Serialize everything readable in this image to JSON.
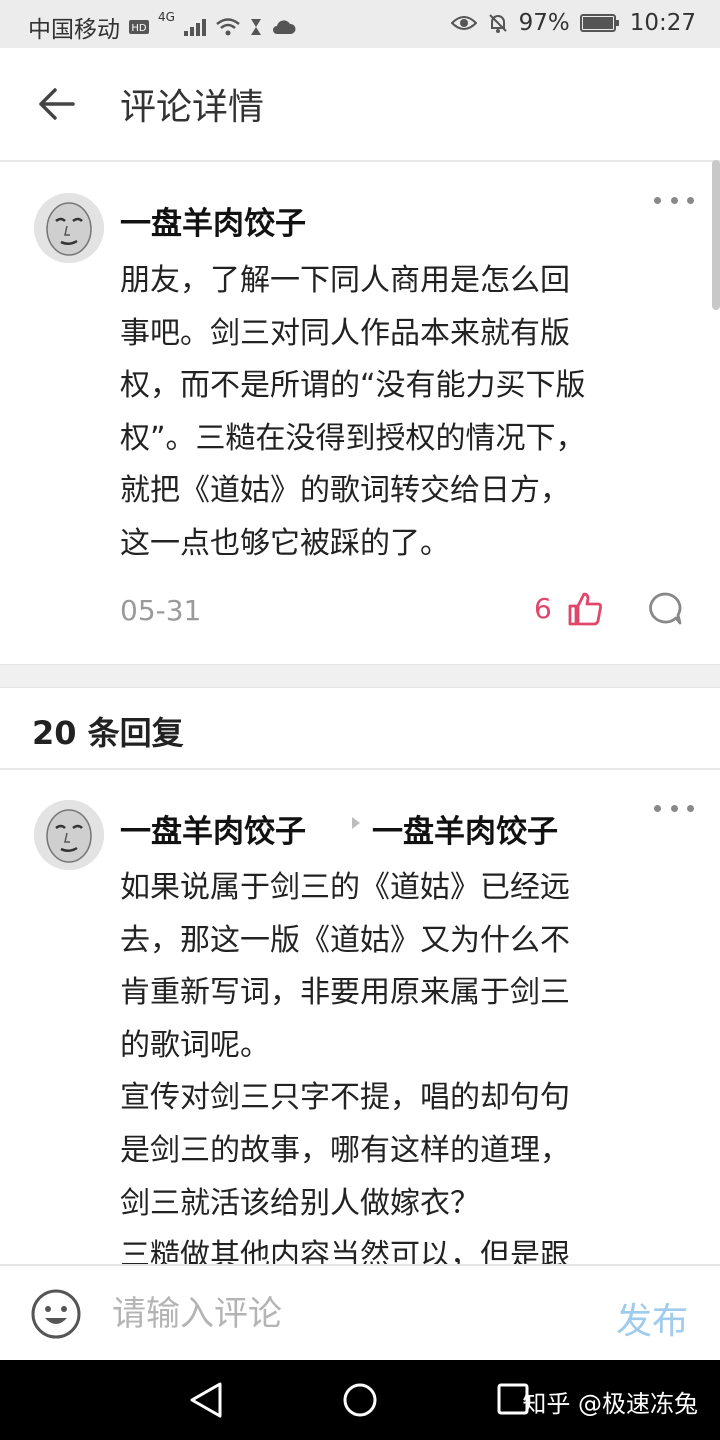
{
  "status_bar": {
    "carrier": "中国移动",
    "network": "4G",
    "battery": "97%",
    "time": "10:27"
  },
  "header": {
    "title": "评论详情"
  },
  "main_comment": {
    "author": "一盘羊肉饺子",
    "lines": [
      "朋友，了解一下同人商用是怎么回",
      "事吧。剑三对同人作品本来就有版",
      "权，而不是所谓的“没有能力买下版",
      "权”。三糙在没得到授权的情况下，",
      "就把《道姑》的歌词转交给日方，",
      "这一点也够它被踩的了。"
    ],
    "date": "05-31",
    "likes": "6"
  },
  "replies_heading": "20 条回复",
  "reply": {
    "author": "一盘羊肉饺子",
    "reply_to": "一盘羊肉饺子",
    "lines": [
      "如果说属于剑三的《道姑》已经远",
      "去，那这一版《道姑》又为什么不",
      "肯重新写词，非要用原来属于剑三",
      "的歌词呢。",
      "宣传对剑三只字不提，唱的却句句",
      "是剑三的故事，哪有这样的道理，",
      "剑三就活该给别人做嫁衣？",
      "三糙做其他内容当然可以，但是跟"
    ]
  },
  "input_bar": {
    "placeholder": "请输入评论",
    "publish_label": "发布"
  },
  "watermark": "知乎 @极速冻兔",
  "colors": {
    "like": "#e0476b",
    "publish": "#9fcbec"
  }
}
